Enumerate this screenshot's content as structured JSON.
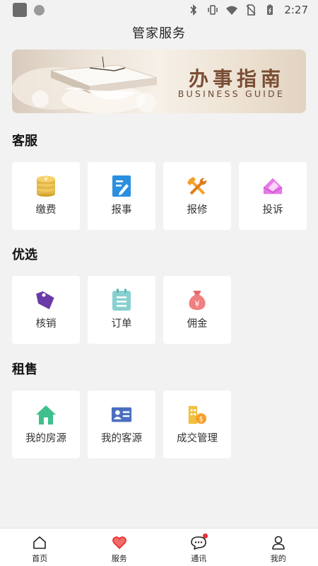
{
  "status_bar": {
    "time": "2:27"
  },
  "header": {
    "title": "管家服务"
  },
  "banner": {
    "title": "办事指南",
    "subtitle": "BUSINESS GUIDE"
  },
  "sections": [
    {
      "title": "客服",
      "items": [
        {
          "label": "缴费",
          "icon": "coins-icon"
        },
        {
          "label": "报事",
          "icon": "edit-document-icon"
        },
        {
          "label": "报修",
          "icon": "tools-icon"
        },
        {
          "label": "投诉",
          "icon": "envelope-icon"
        }
      ]
    },
    {
      "title": "优选",
      "items": [
        {
          "label": "核销",
          "icon": "tag-icon"
        },
        {
          "label": "订单",
          "icon": "clipboard-icon"
        },
        {
          "label": "佣金",
          "icon": "money-bag-icon"
        }
      ]
    },
    {
      "title": "租售",
      "items": [
        {
          "label": "我的房源",
          "icon": "house-icon"
        },
        {
          "label": "我的客源",
          "icon": "id-card-icon"
        },
        {
          "label": "成交管理",
          "icon": "deal-icon"
        }
      ]
    }
  ],
  "bottom_nav": [
    {
      "label": "首页",
      "icon": "home-icon"
    },
    {
      "label": "服务",
      "icon": "heart-icon"
    },
    {
      "label": "通讯",
      "icon": "chat-icon"
    },
    {
      "label": "我的",
      "icon": "user-icon"
    }
  ],
  "colors": {
    "accent": "#e8302e",
    "background": "#f2f2f2",
    "banner_text": "#7a4e34"
  }
}
